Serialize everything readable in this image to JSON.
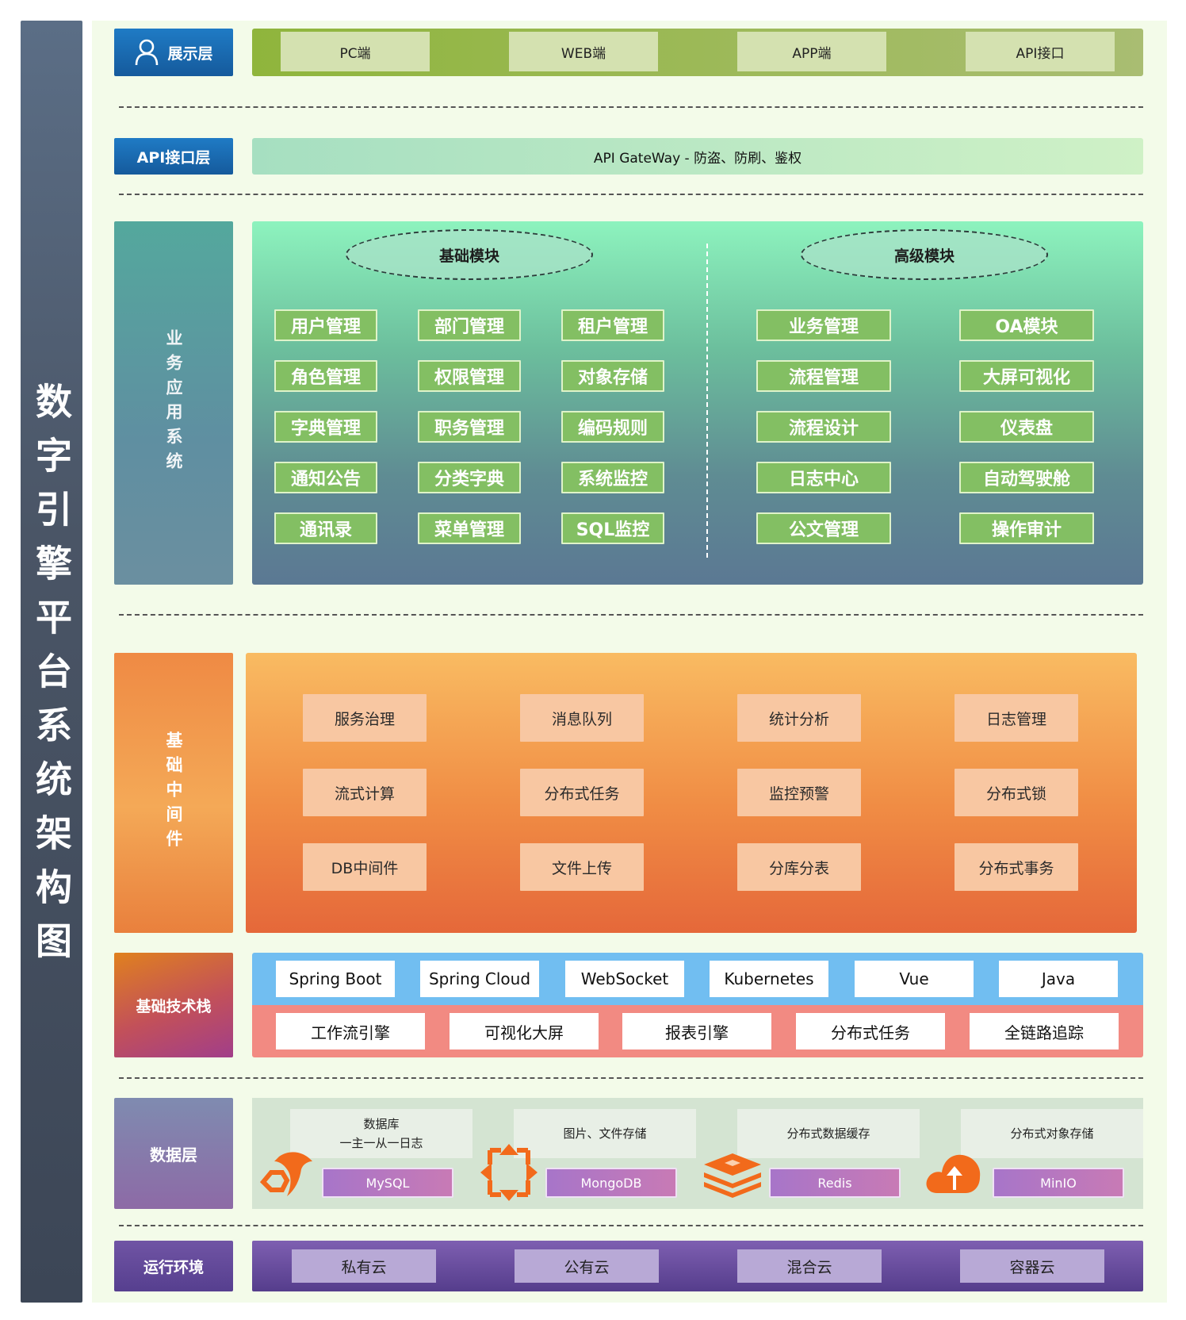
{
  "title": "数字引擎平台系统架构图",
  "presentation": {
    "label": "展示层",
    "items": [
      "PC端",
      "WEB端",
      "APP端",
      "API接口"
    ]
  },
  "api_layer": {
    "label": "API接口层",
    "text": "API GateWay - 防盗、防刷、鉴权"
  },
  "business": {
    "label": "业务应用系统",
    "basic": {
      "title": "基础模块",
      "items": [
        "用户管理",
        "部门管理",
        "租户管理",
        "角色管理",
        "权限管理",
        "对象存储",
        "字典管理",
        "职务管理",
        "编码规则",
        "通知公告",
        "分类字典",
        "系统监控",
        "通讯录",
        "菜单管理",
        "SQL监控"
      ]
    },
    "advanced": {
      "title": "高级模块",
      "items": [
        "业务管理",
        "OA模块",
        "流程管理",
        "大屏可视化",
        "流程设计",
        "仪表盘",
        "日志中心",
        "自动驾驶舱",
        "公文管理",
        "操作审计"
      ]
    }
  },
  "middleware": {
    "label": "基础中间件",
    "items": [
      "服务治理",
      "消息队列",
      "统计分析",
      "日志管理",
      "流式计算",
      "分布式任务",
      "监控预警",
      "分布式锁",
      "DB中间件",
      "文件上传",
      "分库分表",
      "分布式事务"
    ]
  },
  "tech_stack": {
    "label": "基础技术栈",
    "row1": [
      "Spring Boot",
      "Spring Cloud",
      "WebSocket",
      "Kubernetes",
      "Vue",
      "Java"
    ],
    "row2": [
      "工作流引擎",
      "可视化大屏",
      "报表引擎",
      "分布式任务",
      "全链路追踪"
    ]
  },
  "data_layer": {
    "label": "数据层",
    "items": [
      {
        "desc1": "数据库",
        "desc2": "一主一从一日志",
        "tag": "MySQL",
        "icon": "mysql-dolphin-icon"
      },
      {
        "desc1": "图片、文件存储",
        "desc2": "",
        "tag": "MongoDB",
        "icon": "mongodb-icon"
      },
      {
        "desc1": "分布式数据缓存",
        "desc2": "",
        "tag": "Redis",
        "icon": "redis-stack-icon"
      },
      {
        "desc1": "分布式对象存储",
        "desc2": "",
        "tag": "MinIO",
        "icon": "cloud-upload-icon"
      }
    ]
  },
  "runtime": {
    "label": "运行环境",
    "items": [
      "私有云",
      "公有云",
      "混合云",
      "容器云"
    ]
  },
  "colors": {
    "accent_blue": "#1f7bc5",
    "module_green": "#83bf63",
    "middleware_orange": "#f08c44",
    "icon_orange": "#f26a1b"
  }
}
